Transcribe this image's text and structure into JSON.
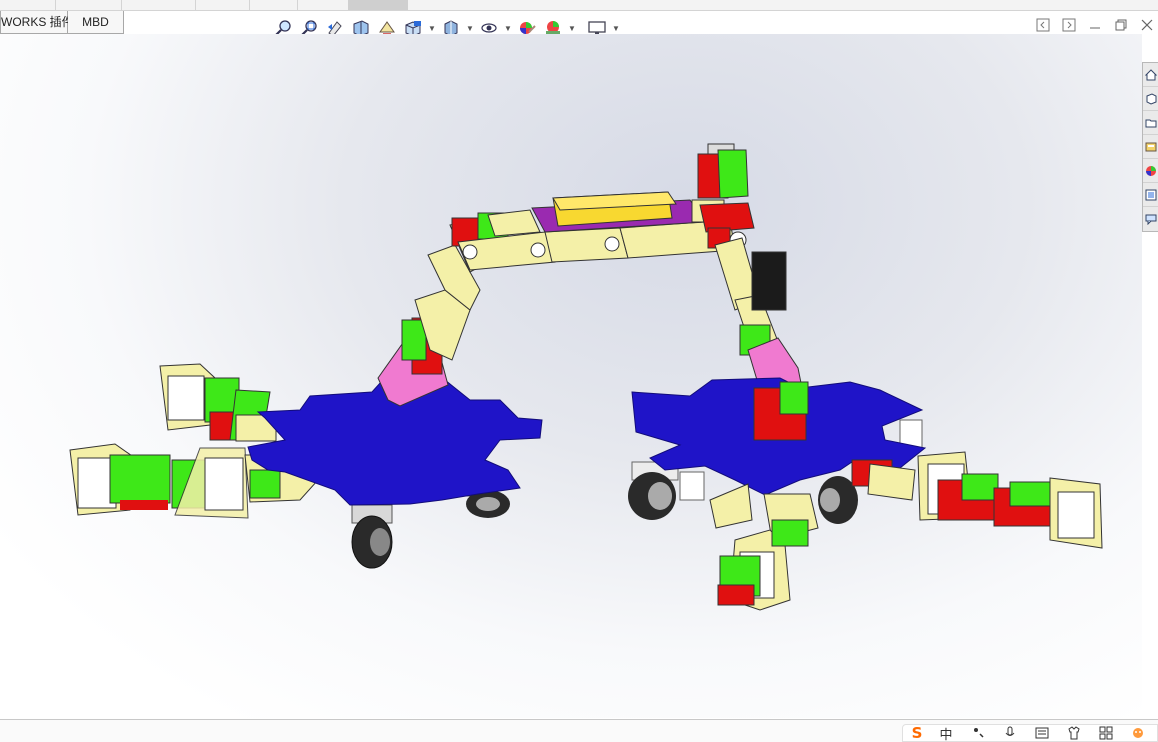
{
  "tabs": [
    {
      "label": "WORKS 插件"
    },
    {
      "label": "MBD"
    }
  ],
  "heads_up_toolbar": {
    "icons": [
      "zoom-to-fit-icon",
      "zoom-area-icon",
      "previous-view-icon",
      "section-view-icon",
      "dynamic-annotation-icon",
      "view-orientation-icon",
      "display-style-icon",
      "hide-show-icon",
      "edit-appearance-icon",
      "apply-scene-icon",
      "view-settings-icon"
    ]
  },
  "window_controls": [
    "tile-left-icon",
    "tile-right-icon",
    "minimize-icon",
    "restore-icon",
    "close-icon"
  ],
  "task_pane": [
    "home-icon",
    "resources-icon",
    "design-library-icon",
    "file-explorer-icon",
    "appearances-icon",
    "custom-properties-icon",
    "forum-icon"
  ],
  "ime_toolbar": {
    "logo": "S",
    "mode": "中",
    "icons": [
      "punctuation-icon",
      "microphone-icon",
      "keyboard-icon",
      "skin-icon",
      "toolbox-icon",
      "more-icon"
    ]
  },
  "colors": {
    "base_plate": "#1f14c8",
    "bracket": "#f4f0a8",
    "servo_green": "#3ee818",
    "servo_red": "#e01010",
    "pink_part": "#f07ad0",
    "battery": "#f8d830",
    "top_plate": "#9a2ab0",
    "wheel": "#2a2a2a"
  }
}
